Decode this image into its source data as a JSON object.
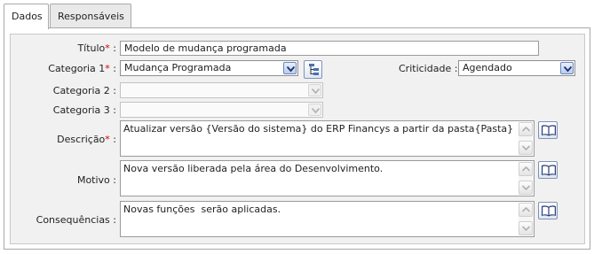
{
  "tabs": [
    {
      "label": "Dados"
    },
    {
      "label": "Responsáveis"
    }
  ],
  "form": {
    "titulo": {
      "label": "Título",
      "required_mark": "*",
      "value": "Modelo de mudança programada"
    },
    "categoria1": {
      "label": "Categoria 1",
      "required_mark": "*",
      "value": "Mudança Programada"
    },
    "criticidade": {
      "label": "Criticidade :",
      "value": "Agendado"
    },
    "categoria2": {
      "label": "Categoria 2 :",
      "value": ""
    },
    "categoria3": {
      "label": "Categoria 3 :",
      "value": ""
    },
    "descricao": {
      "label": "Descrição",
      "required_mark": "*",
      "value": "Atualizar versão {Versão do sistema} do ERP Financys a partir da pasta{Pasta}"
    },
    "motivo": {
      "label": "Motivo :",
      "value": "Nova versão liberada pela área do Desenvolvimento."
    },
    "consequencias": {
      "label": "Consequências :",
      "value": "Novas funções  serão aplicadas."
    },
    "colon": " :"
  },
  "icons": {
    "tree": "tree-icon",
    "book": "book-icon",
    "dropdown": "chevron-down-icon"
  }
}
